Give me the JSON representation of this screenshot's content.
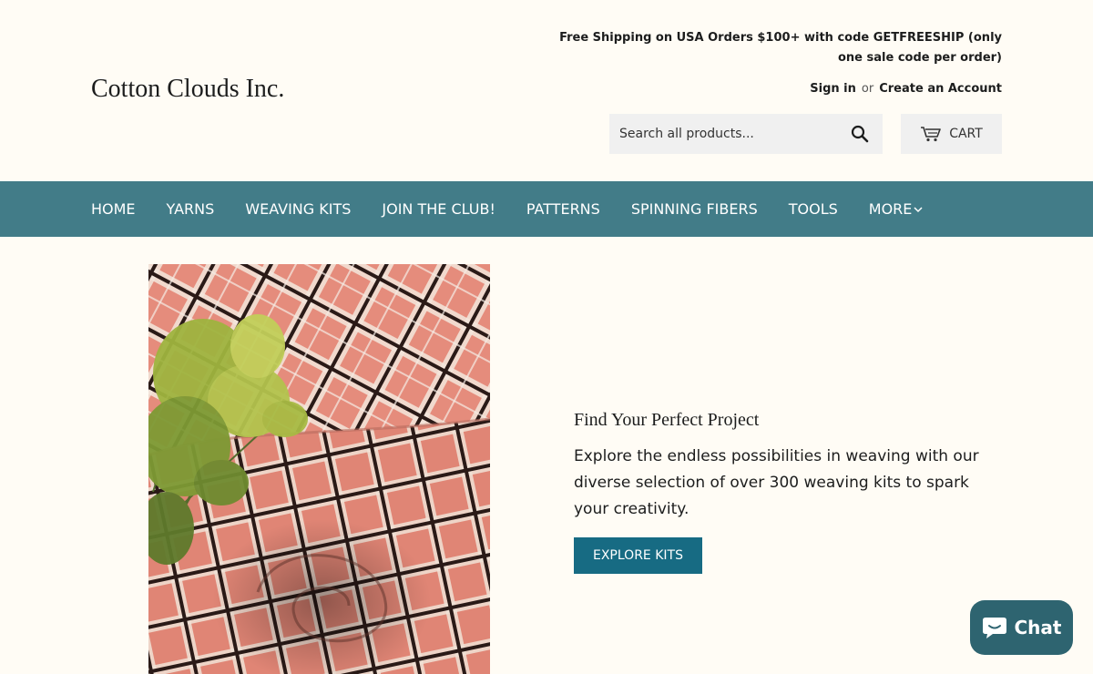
{
  "header": {
    "logo": "Cotton Clouds Inc.",
    "promo": "Free Shipping on USA Orders $100+ with code GETFREESHIP (only one sale code per order)",
    "sign_in": "Sign in",
    "or": "or",
    "create_account": "Create an Account",
    "search_placeholder": "Search all products...",
    "cart_label": "CART"
  },
  "nav": {
    "items": [
      "HOME",
      "YARNS",
      "WEAVING KITS",
      "JOIN THE CLUB!",
      "PATTERNS",
      "SPINNING FIBERS",
      "TOOLS",
      "MORE"
    ]
  },
  "hero": {
    "title": "Find Your Perfect Project",
    "description": "Explore the endless possibilities in weaving with our diverse selection of over 300 weaving kits to spark your creativity.",
    "button": "EXPLORE KITS"
  },
  "chat": {
    "label": "Chat"
  },
  "icons": {
    "search": "search-icon",
    "cart": "cart-icon",
    "chevron": "chevron-down-icon",
    "chat": "chat-bubble-icon"
  },
  "colors": {
    "nav_bg": "#427c88",
    "button_bg": "#176b83",
    "chat_bg": "#2e6470",
    "page_bg": "#fffcf5"
  }
}
